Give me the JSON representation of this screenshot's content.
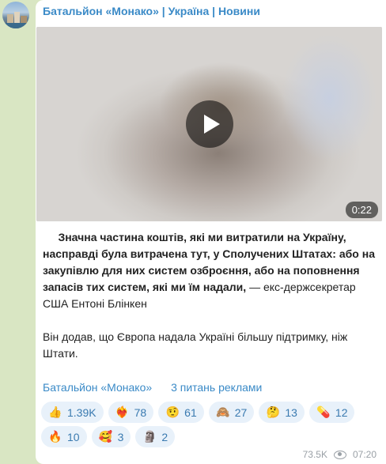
{
  "channel": {
    "title": "Батальйон «Монако» | Україна | Новини"
  },
  "video": {
    "duration": "0:22"
  },
  "post": {
    "bold_text": "Значна частина коштів, які ми витратили на Україну, насправді була витрачена тут, у Сполучених Штатах: або на закупівлю для них систем озброєння, або на поповнення запасів тих систем, які ми їм надали,",
    "normal_text": " — екс-держсекретар США Ентоні Блінкен",
    "paragraph2": "Він додав, що Європа надала Україні більшу підтримку, ніж Штати."
  },
  "links": {
    "channel_link": "Батальйон «Монако»",
    "ads_link": "3 питань реклами"
  },
  "reactions": [
    {
      "emoji": "👍",
      "icon": "thumbs-up-icon",
      "count": "1.39K"
    },
    {
      "emoji": "❤️‍🔥",
      "icon": "heart-on-fire-icon",
      "count": "78"
    },
    {
      "emoji": "🤨",
      "icon": "raised-eyebrow-icon",
      "count": "61"
    },
    {
      "emoji": "🙈",
      "icon": "see-no-evil-monkey-icon",
      "count": "27"
    },
    {
      "emoji": "🤔",
      "icon": "thinking-face-icon",
      "count": "13"
    },
    {
      "emoji": "💊",
      "icon": "pill-icon",
      "count": "12"
    },
    {
      "emoji": "🔥",
      "icon": "fire-icon",
      "count": "10"
    },
    {
      "emoji": "🥰",
      "icon": "smiling-hearts-icon",
      "count": "3"
    },
    {
      "emoji": "🗿",
      "icon": "moai-icon",
      "count": "2"
    }
  ],
  "meta": {
    "views": "73.5K",
    "time": "07:20"
  }
}
